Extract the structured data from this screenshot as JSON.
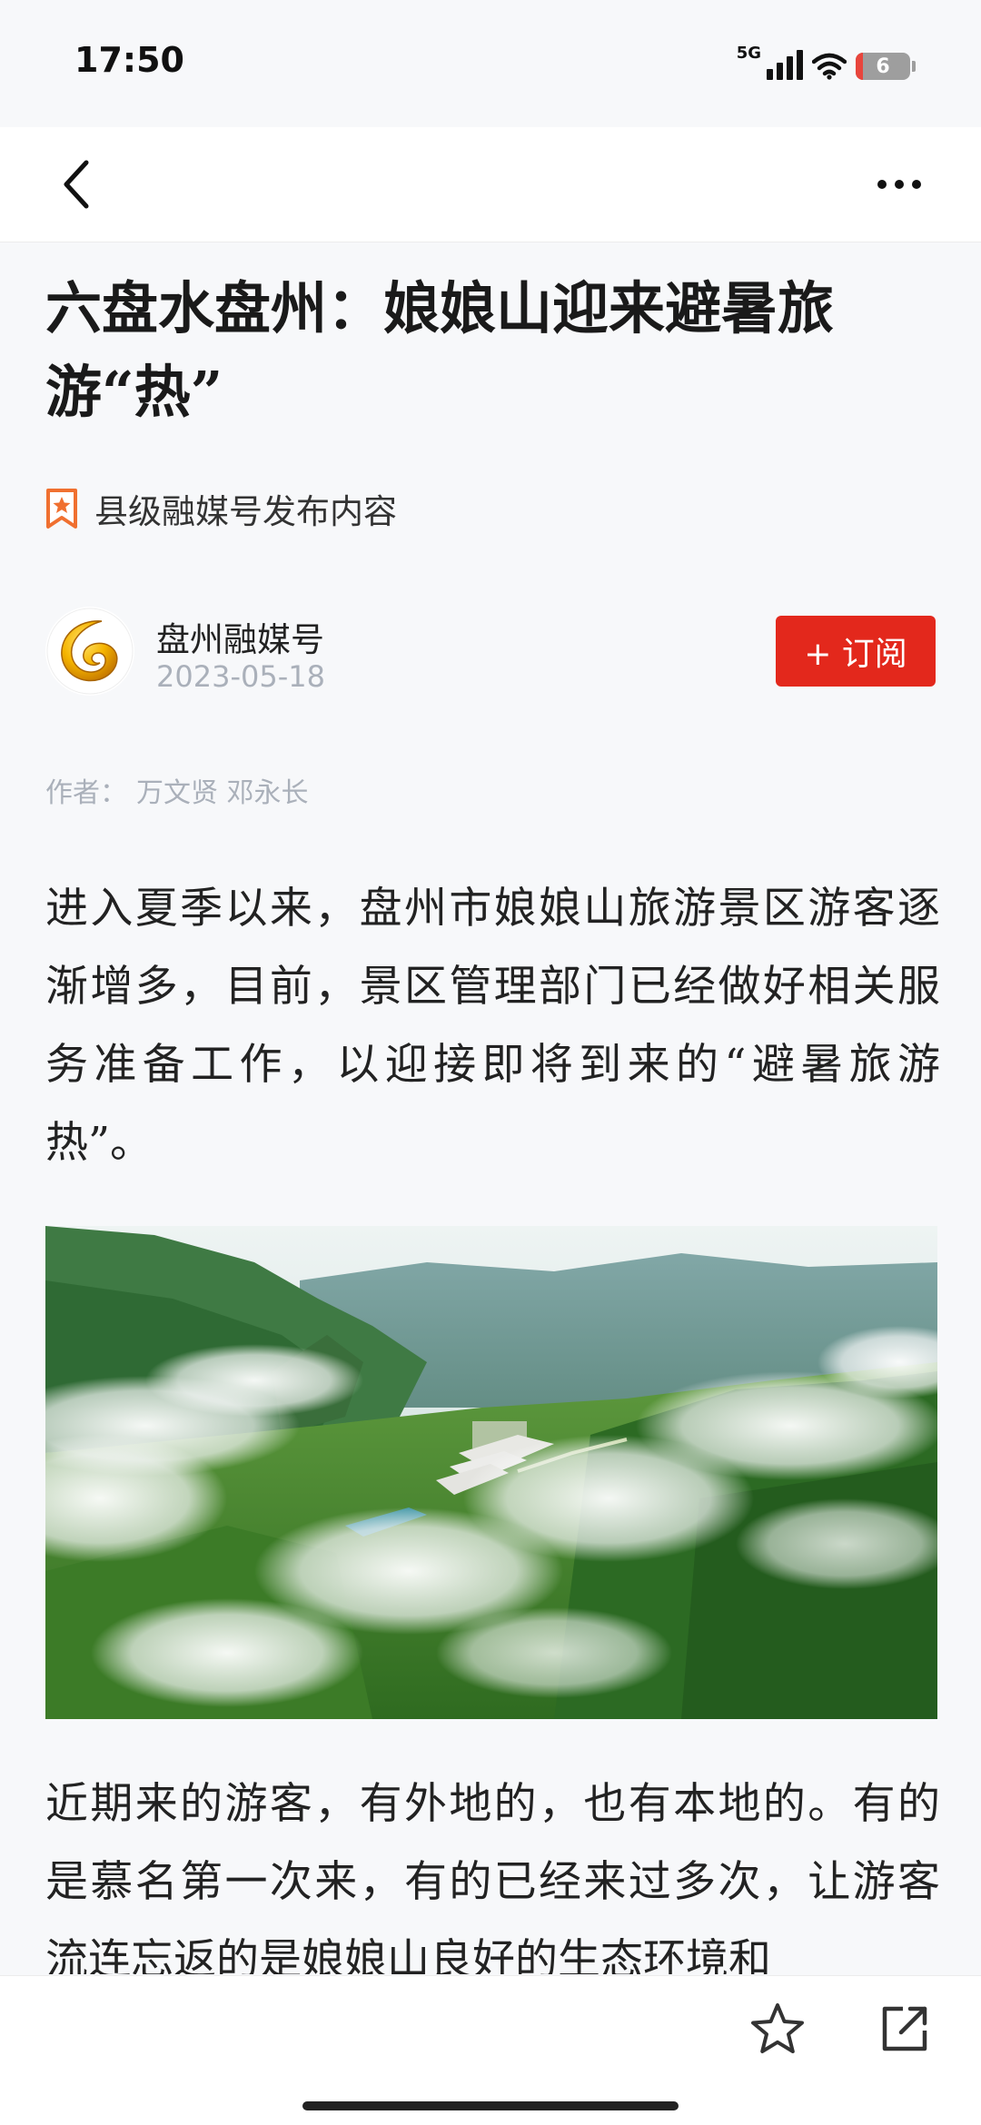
{
  "status_bar": {
    "time": "17:50",
    "network": "5G",
    "battery": "6"
  },
  "nav": {
    "back_icon": "chevron-left-icon",
    "more_icon": "more-horizontal-icon"
  },
  "article": {
    "title": "六盘水盘州：娘娘山迎来避暑旅游“热”",
    "tag": "县级融媒号发布内容",
    "tag_icon": "bookmark-star-icon",
    "source_name": "盘州融媒号",
    "date": "2023-05-18",
    "subscribe_label": "+ 订阅",
    "byline_label": "作者：",
    "byline_authors": "万文贤 邓永长",
    "paragraph1": "进入夏季以来，盘州市娘娘山旅游景区游客逐渐增多，目前，景区管理部门已经做好相关服务准备工作，以迎接即将到来的“避暑旅游热”。",
    "paragraph2": "近期来的游客，有外地的，也有本地的。有的是慕名第一次来，有的已经来过多次，让游客流连忘返的是娘娘山良好的生态环境和"
  },
  "bottom_bar": {
    "star_icon": "star-outline-icon",
    "share_icon": "share-external-icon"
  },
  "colors": {
    "accent": "#e3281c",
    "muted_text": "#aab0ba",
    "background": "#f7f8fa"
  }
}
